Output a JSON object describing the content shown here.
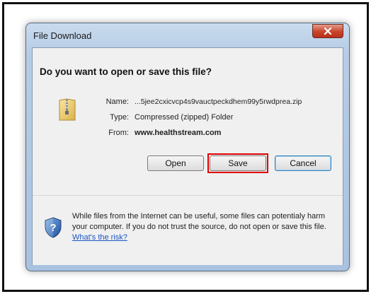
{
  "dialog": {
    "title": "File Download",
    "close_label": "x",
    "question": "Do you want to open or save this file?",
    "file_info": {
      "name_label": "Name:",
      "name_value": "...5jee2cxicvcp4s9vauctpeckdhem99y5rwdprea.zip",
      "type_label": "Type:",
      "type_value": "Compressed (zipped) Folder",
      "from_label": "From:",
      "from_value": "www.healthstream.com"
    },
    "buttons": {
      "open": "Open",
      "save": "Save",
      "cancel": "Cancel"
    },
    "warning": {
      "text": "While files from the Internet can be useful, some files can potentialy harm your computer. If you do not trust the source, do not open or save this file. ",
      "link": "What's the risk?"
    }
  },
  "colors": {
    "highlight": "#e00000",
    "link": "#1a55c4",
    "close_button": "#c9442a"
  },
  "icons": [
    "close-icon",
    "zip-folder-icon",
    "security-shield-icon"
  ]
}
